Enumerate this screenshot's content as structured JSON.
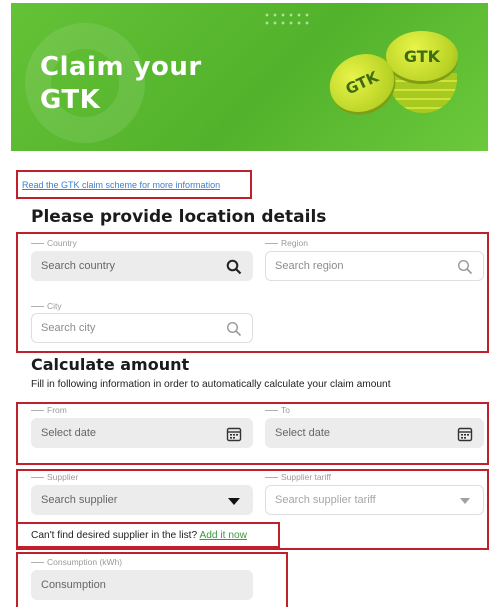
{
  "banner": {
    "title_line1": "Claim your",
    "title_line2": "GTK",
    "coin_front_text": "GTK",
    "coin_back_text": "GTK"
  },
  "info_link": "Read the GTK claim scheme for more information",
  "location": {
    "heading": "Please provide location details",
    "country_label": "Country",
    "country_placeholder": "Search country",
    "region_label": "Region",
    "region_placeholder": "Search region",
    "city_label": "City",
    "city_placeholder": "Search city"
  },
  "calculate": {
    "heading": "Calculate amount",
    "description": "Fill in following information in order to automatically calculate your claim amount",
    "from_label": "From",
    "from_placeholder": "Select date",
    "to_label": "To",
    "to_placeholder": "Select date",
    "supplier_label": "Supplier",
    "supplier_placeholder": "Search supplier",
    "tariff_label": "Supplier tariff",
    "tariff_placeholder": "Search supplier tariff",
    "cant_find_text": "Can't find desired supplier in the list?",
    "add_it_now": "Add it now",
    "consumption_label": "Consumption (kWh)",
    "consumption_placeholder": "Consumption"
  },
  "colors": {
    "banner_green": "#5ab82f",
    "highlight_red": "#c0202c",
    "link_blue": "#3a7fd0",
    "link_green": "#3a9a3a"
  },
  "icons": {
    "search": "search-icon",
    "calendar": "calendar-icon",
    "dropdown": "caret-down-icon"
  }
}
